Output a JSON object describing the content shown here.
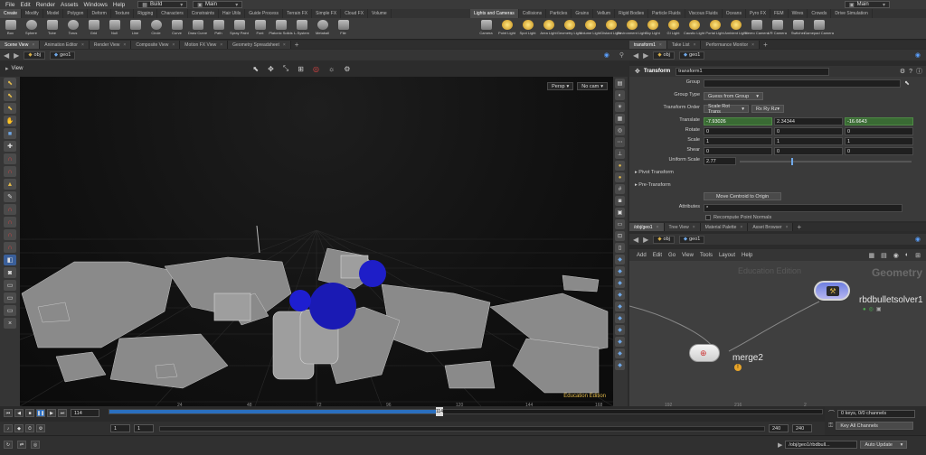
{
  "menubar": {
    "items": [
      "File",
      "Edit",
      "Render",
      "Assets",
      "Windows",
      "Help"
    ],
    "build": "Build",
    "desktop": "Main",
    "right_desktop": "Main"
  },
  "shelf_tabs_left": [
    "Create",
    "Modify",
    "Model",
    "Polygon",
    "Deform",
    "Texture",
    "Rigging",
    "Characters",
    "Constraints",
    "Hair Utils",
    "Guide Process",
    "Terrain FX",
    "Simple FX",
    "Cloud FX",
    "Volume"
  ],
  "shelf_tabs_right": [
    "Lights and Cameras",
    "Collisions",
    "Particles",
    "Grains",
    "Vellum",
    "Rigid Bodies",
    "Particle Fluids",
    "Viscous Fluids",
    "Oceans",
    "Pyro FX",
    "FEM",
    "Wires",
    "Crowds",
    "Drive Simulation"
  ],
  "tools_left": [
    "Box",
    "Sphere",
    "Tube",
    "Torus",
    "Grid",
    "Null",
    "Line",
    "Circle",
    "Curve",
    "Draw Curve",
    "Path",
    "Spray Paint",
    "Font",
    "Platonic Solids",
    "L-System",
    "Metaball",
    "File"
  ],
  "tools_right": [
    "Camera",
    "Point Light",
    "Spot Light",
    "Area Light",
    "Geometry Light",
    "Volume Light",
    "Distant Light",
    "Environment Light",
    "Sky Light",
    "GI Light",
    "Caustic Light",
    "Portal Light",
    "Ambient Light",
    "Stereo Camera",
    "VR Camera",
    "Switcher",
    "Gamepad Camera"
  ],
  "left_pane_tabs": [
    "Scene View",
    "Animation Editor",
    "Render View",
    "Composite View",
    "Motion FX View",
    "Geometry Spreadsheet"
  ],
  "right_pane_tabs": [
    "transform1",
    "Take List",
    "Performance Monitor"
  ],
  "path_left": {
    "obj": "obj",
    "geo": "geo1"
  },
  "viewport": {
    "label": "View",
    "persp": "Persp",
    "cam": "No cam",
    "watermark": "Education Edition"
  },
  "params": {
    "node_type": "Transform",
    "node_name": "transform1",
    "group_label": "Group",
    "group_value": "",
    "group_type_label": "Group Type",
    "group_type_value": "Guess from Group",
    "xform_order_label": "Transform Order",
    "xform_order_value": "Scale Rot Trans",
    "rot_order_value": "Rx Ry Rz",
    "translate_label": "Translate",
    "translate": [
      "-7.93026",
      "2.34344",
      "-16.6643"
    ],
    "rotate_label": "Rotate",
    "rotate": [
      "0",
      "0",
      "0"
    ],
    "scale_label": "Scale",
    "scale": [
      "1",
      "1",
      "1"
    ],
    "shear_label": "Shear",
    "shear": [
      "0",
      "0",
      "0"
    ],
    "uniform_scale_label": "Uniform Scale",
    "uniform_scale": "2.77",
    "uniform_scale_fraction": 0.3,
    "pivot_section": "Pivot Transform",
    "pretransform_section": "Pre-Transform",
    "move_centroid": "Move Centroid to Origin",
    "attributes_label": "Attributes",
    "attributes_value": "*",
    "recompute_label": "Recompute Point Normals"
  },
  "net_tabs": [
    "/obj/geo1",
    "Tree View",
    "Material Palette",
    "Asset Browser"
  ],
  "path_right": {
    "obj": "obj",
    "geo": "geo1"
  },
  "net_menu": [
    "Add",
    "Edit",
    "Go",
    "View",
    "Tools",
    "Layout",
    "Help"
  ],
  "network": {
    "watermark": "Education Edition",
    "context": "Geometry",
    "node1": "rbdbulletsolver1",
    "node2": "merge2"
  },
  "timeline": {
    "ticks": [
      "24",
      "48",
      "72",
      "96",
      "120",
      "144",
      "168",
      "192",
      "216",
      "2"
    ],
    "current_frame": "114",
    "cursor_frame": "114",
    "start": "1",
    "start2": "1",
    "end": "240",
    "end2": "240",
    "range_fraction": 0.46
  },
  "channels": {
    "keys": "0 keys, 0/0 channels",
    "key_all": "Key All Channels"
  },
  "status": {
    "path": "/obj/geo1/rbdbull...",
    "auto_update": "Auto Update"
  }
}
